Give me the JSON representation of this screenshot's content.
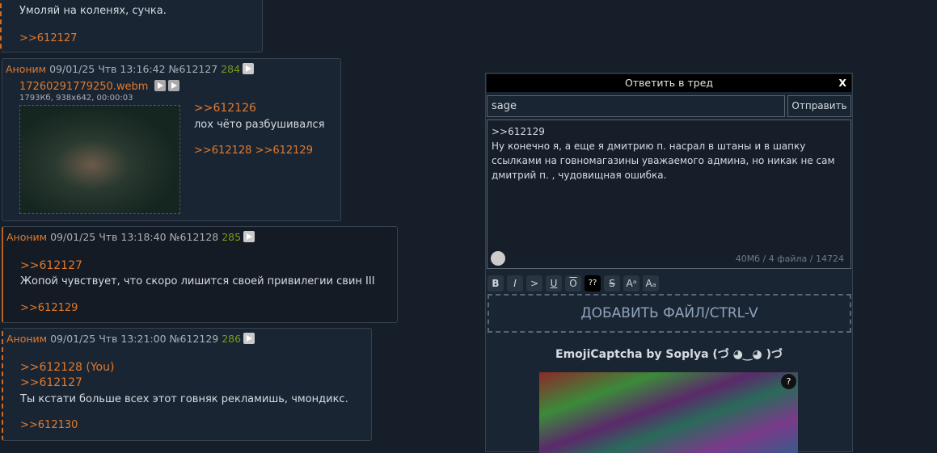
{
  "posts": [
    {
      "text": "Умоляй на коленях, сучка.",
      "replies": [
        ">>612127"
      ]
    },
    {
      "name": "Аноним",
      "date": "09/01/25 Чтв 13:16:42",
      "num": "№612127",
      "count": "284",
      "file": {
        "name": "17260291779250.webm",
        "meta": "1793Кб, 938x642, 00:00:03"
      },
      "quote": ">>612126",
      "text": "лох чёто разбушивался",
      "replies": [
        ">>612128",
        ">>612129"
      ]
    },
    {
      "name": "Аноним",
      "date": "09/01/25 Чтв 13:18:40",
      "num": "№612128",
      "count": "285",
      "quote": ">>612127",
      "text": "Жопой чувствует, что скоро лишится своей привилегии свин III",
      "replies": [
        ">>612129"
      ]
    },
    {
      "name": "Аноним",
      "date": "09/01/25 Чтв 13:21:00",
      "num": "№612129",
      "count": "286",
      "quote": ">>612128 (You)",
      "quote2": ">>612127",
      "text": "Ты кстати больше всех этот говняк рекламишь, чмондикс.",
      "replies": [
        ">>612130"
      ]
    }
  ],
  "form": {
    "title": "Ответить в тред",
    "close": "X",
    "email": "sage",
    "submit": "Отправить",
    "message_lines": [
      ">>612129",
      "Ну конечно я, а еще я дмитрию п. насрал в штаны и в шапку",
      "ссылками на говномагазины уважаемого админа, но никак не сам",
      "дмитрий п. , чудовищная ошибка."
    ],
    "limits": "40Мб / 4 файла / 14724",
    "toolbar": [
      "B",
      "I",
      ">",
      "U",
      "O",
      "??",
      "S",
      "Aᵃ",
      "Aₐ"
    ],
    "dropzone": "ДОБАВИТЬ ФАЙЛ/CTRL-V",
    "captcha_title": "EmojiCaptcha by Soplya (づ ◕‿◕ )づ",
    "captcha_help": "?"
  }
}
